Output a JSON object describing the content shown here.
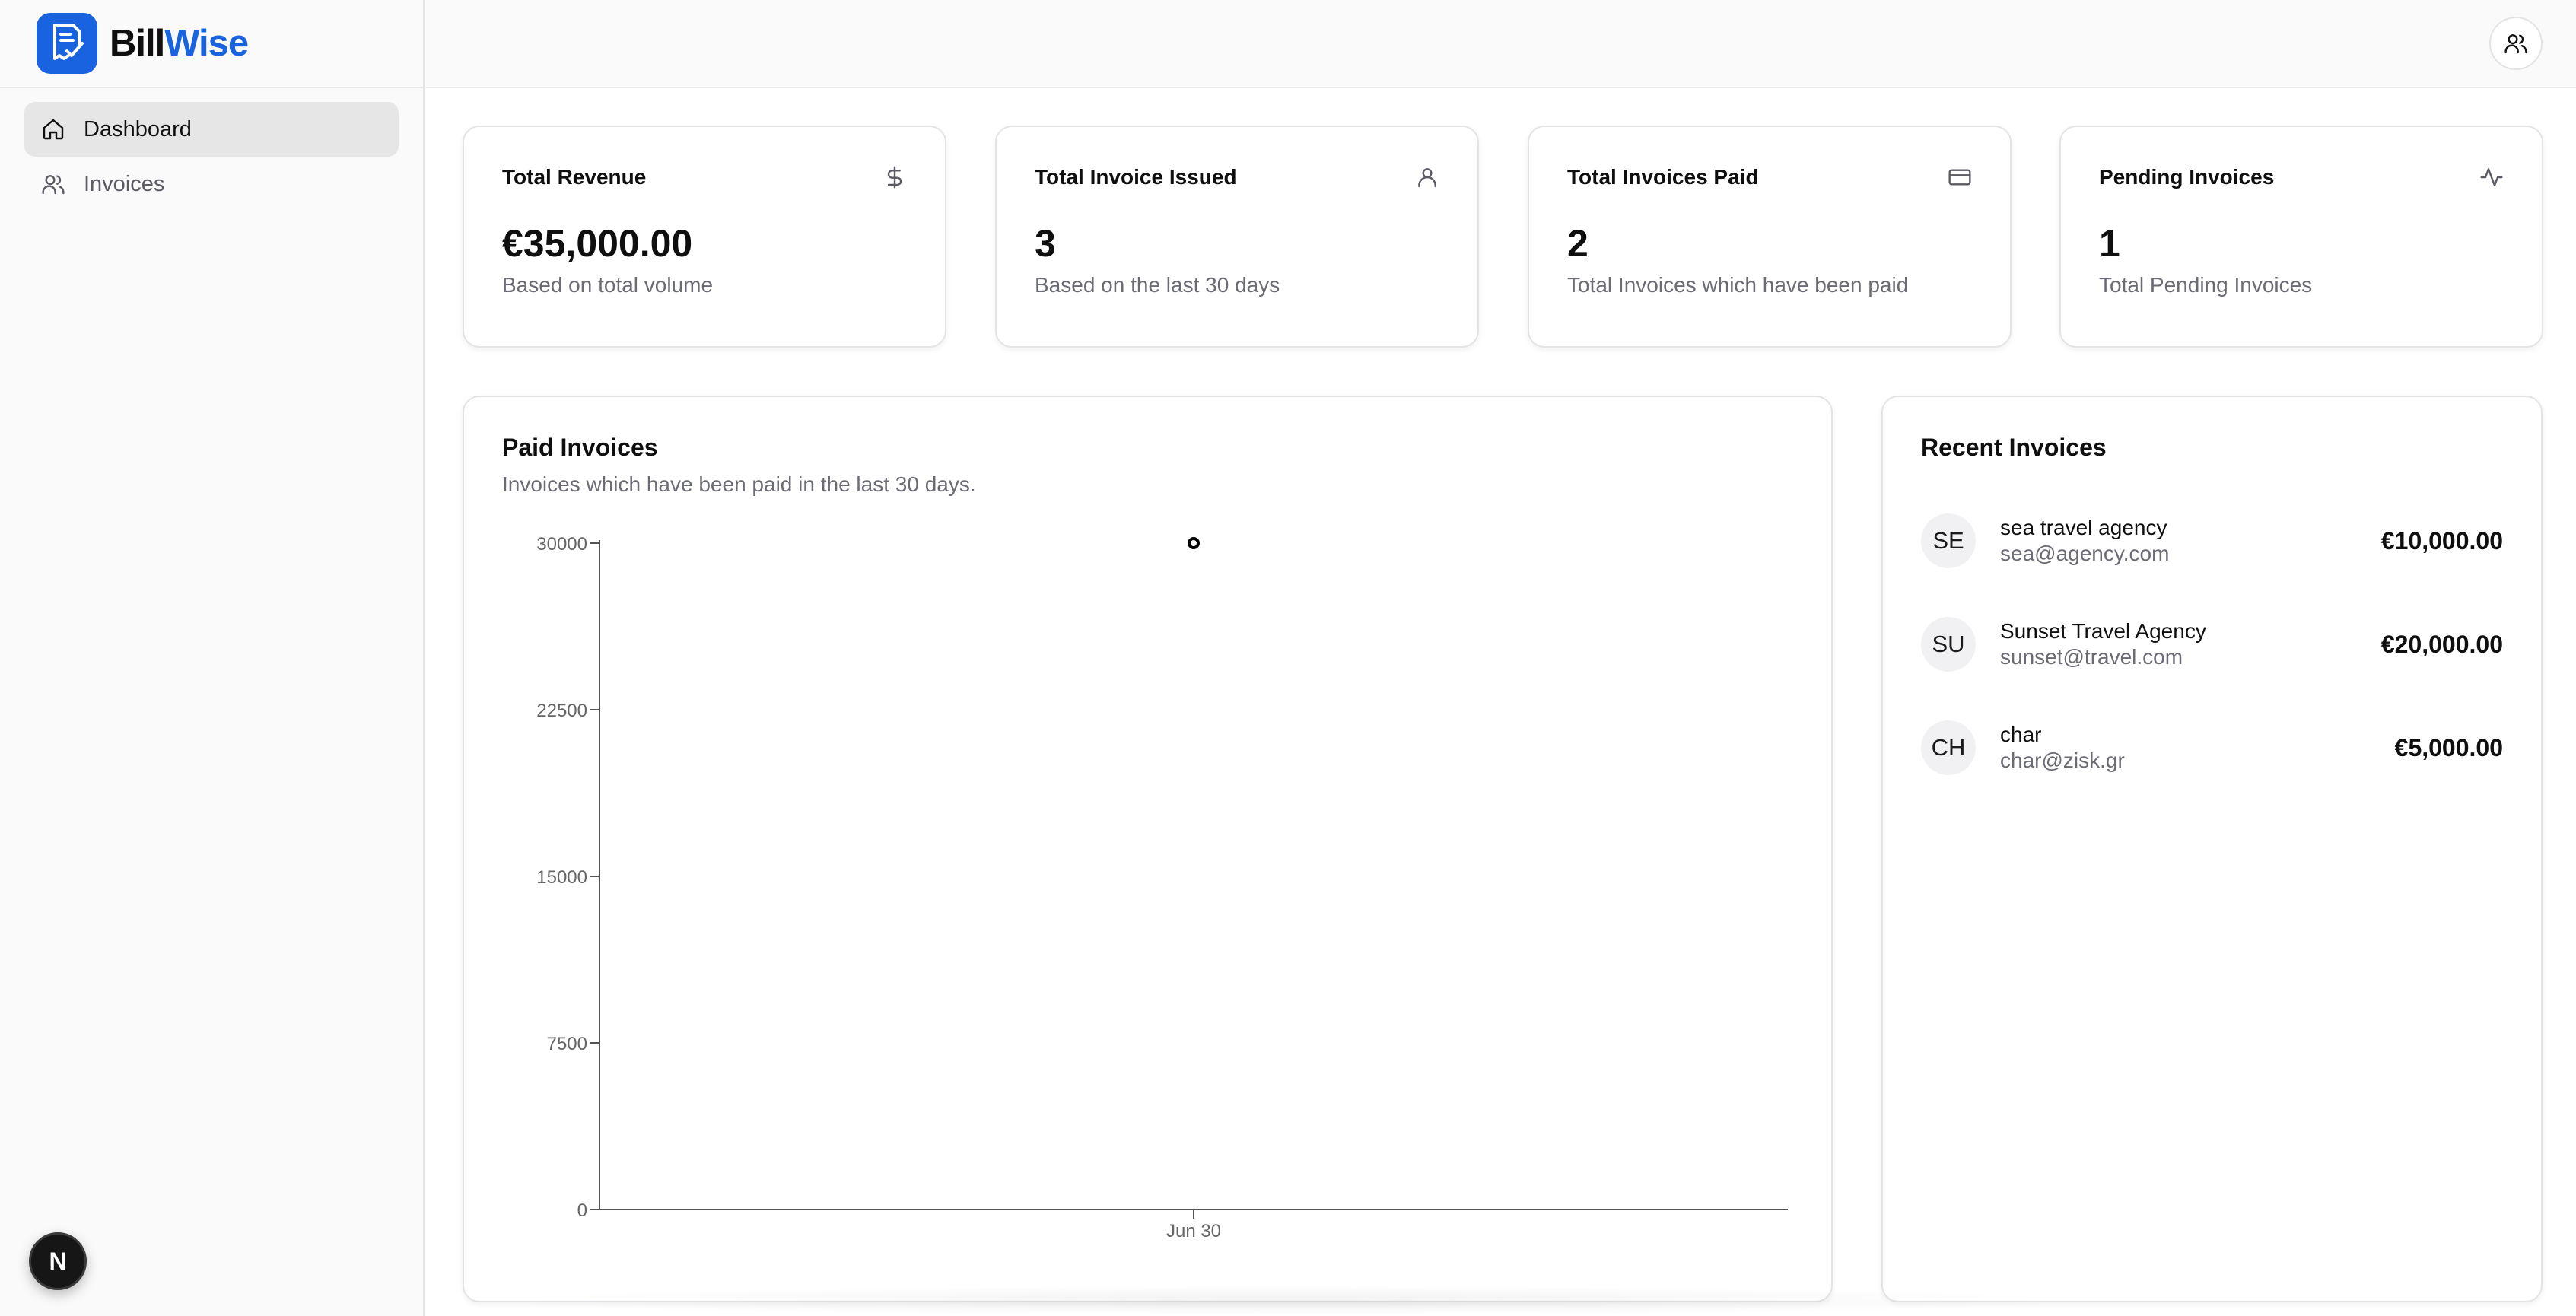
{
  "brand": {
    "part1": "Bill",
    "part2": "Wise",
    "accent_color": "#1a63e0",
    "logo_icon": "invoice-check-icon"
  },
  "sidebar": {
    "items": [
      {
        "label": "Dashboard",
        "icon": "home-icon",
        "active": true
      },
      {
        "label": "Invoices",
        "icon": "users-icon",
        "active": false
      }
    ],
    "fab_label": "N"
  },
  "header": {
    "user_icon": "users-icon"
  },
  "stats": [
    {
      "title": "Total Revenue",
      "value": "€35,000.00",
      "subtitle": "Based on total volume",
      "icon": "dollar-icon"
    },
    {
      "title": "Total Invoice Issued",
      "value": "3",
      "subtitle": "Based on the last 30 days",
      "icon": "user-icon"
    },
    {
      "title": "Total Invoices Paid",
      "value": "2",
      "subtitle": "Total Invoices which have been paid",
      "icon": "credit-card-icon"
    },
    {
      "title": "Pending Invoices",
      "value": "1",
      "subtitle": "Total Pending Invoices",
      "icon": "activity-icon"
    }
  ],
  "paid_invoices": {
    "title": "Paid Invoices",
    "subtitle": "Invoices which have been paid in the last 30 days."
  },
  "chart_data": {
    "type": "line",
    "categories": [
      "Jun 30"
    ],
    "series": [
      {
        "values": [
          30000
        ]
      }
    ],
    "yticks": [
      0,
      7500,
      15000,
      22500,
      30000
    ],
    "ylim": [
      0,
      30000
    ],
    "grid": false
  },
  "recent_invoices": {
    "title": "Recent Invoices",
    "items": [
      {
        "initials": "SE",
        "name": "sea travel agency",
        "email": "sea@agency.com",
        "amount": "€10,000.00"
      },
      {
        "initials": "SU",
        "name": "Sunset Travel Agency",
        "email": "sunset@travel.com",
        "amount": "€20,000.00"
      },
      {
        "initials": "CH",
        "name": "char",
        "email": "char@zisk.gr",
        "amount": "€5,000.00"
      }
    ]
  }
}
